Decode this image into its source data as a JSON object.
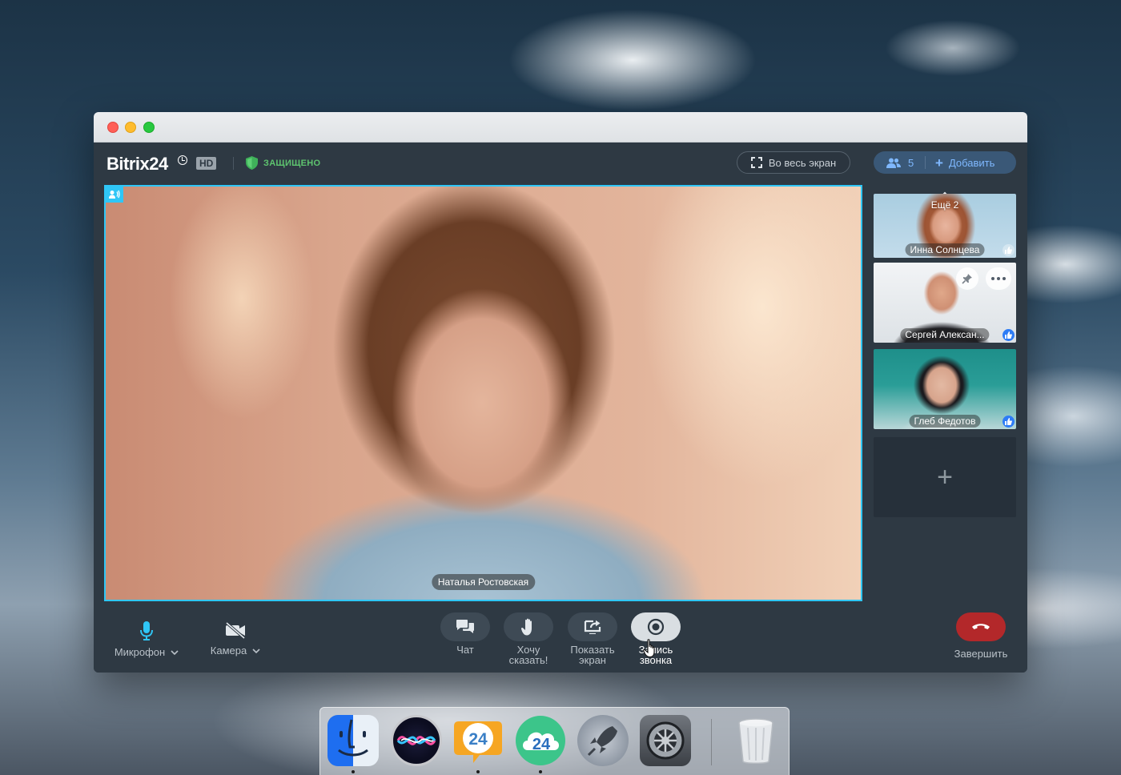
{
  "app": {
    "logo": "Bitrix24",
    "hd_badge": "HD",
    "secure_label": "ЗАЩИЩЕНО",
    "fullscreen_label": "Во весь экран",
    "participants_count": "5",
    "add_label": "Добавить"
  },
  "main_video": {
    "speaker_name": "Наталья Ростовская"
  },
  "side_tiles": {
    "more_label": "Ещё 2",
    "items": [
      {
        "name": "Инна Солнцева"
      },
      {
        "name": "Сергей Алексан..."
      },
      {
        "name": "Глеб Федотов"
      }
    ],
    "add_tile_symbol": "+"
  },
  "controls": {
    "mic_label": "Микрофон",
    "camera_label": "Камера",
    "chat_label": "Чат",
    "hand_label_1": "Хочу",
    "hand_label_2": "сказать!",
    "share_label_1": "Показать",
    "share_label_2": "экран",
    "record_label_1": "Запись",
    "record_label_2": "звонка",
    "end_label": "Завершить"
  },
  "dock": {
    "apps": [
      "Finder",
      "Siri",
      "Bitrix24 Messenger",
      "Bitrix24 Cloud",
      "Launchpad",
      "System Preferences",
      "Trash"
    ],
    "b24_chat_text": "24",
    "b24_cloud_text": "24"
  },
  "colors": {
    "accent": "#2fc6f6",
    "secure_green": "#5ec46f",
    "participants_blue": "#7fb8ff",
    "end_call_red": "#b3282a"
  }
}
